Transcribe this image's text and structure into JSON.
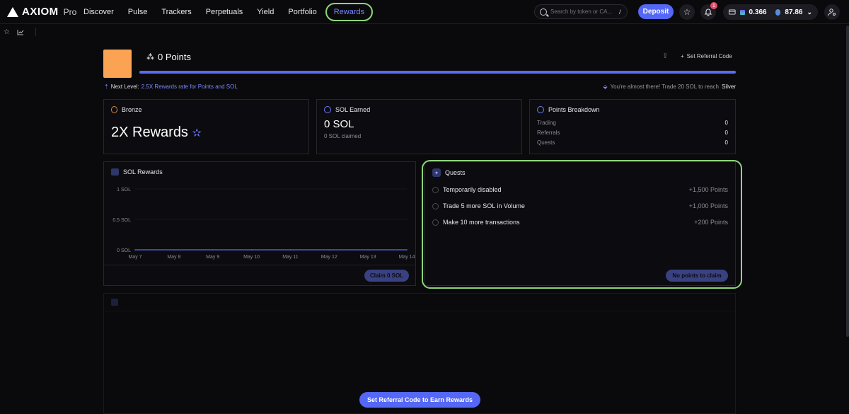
{
  "brand": {
    "name": "AXIOM",
    "tier": "Pro"
  },
  "nav": [
    {
      "label": "Discover"
    },
    {
      "label": "Pulse"
    },
    {
      "label": "Trackers"
    },
    {
      "label": "Perpetuals"
    },
    {
      "label": "Yield"
    },
    {
      "label": "Portfolio"
    },
    {
      "label": "Rewards",
      "active": true
    }
  ],
  "search": {
    "placeholder": "Search by token or CA...",
    "shortcut": "/"
  },
  "deposit_label": "Deposit",
  "notifications": {
    "count": "1"
  },
  "wallet": {
    "sol_balance": "0.366",
    "usd_balance": "87.86"
  },
  "profile": {
    "points": "0 Points",
    "set_referral": "Set Referral Code",
    "progress_pct": 100
  },
  "next_level": {
    "prefix": "Next Level:",
    "text": "2.5X Rewards rate for Points and SOL"
  },
  "almost": {
    "text": "You're almost there! Trade 20 SOL to reach",
    "tier": "Silver"
  },
  "bronze": {
    "title": "Bronze",
    "headline": "2X Rewards"
  },
  "sol_earned": {
    "title": "SOL Earned",
    "value": "0 SOL",
    "claimed": "0 SOL claimed"
  },
  "points_breakdown": {
    "title": "Points Breakdown",
    "rows": [
      {
        "label": "Trading",
        "value": "0"
      },
      {
        "label": "Referrals",
        "value": "0"
      },
      {
        "label": "Quests",
        "value": "0"
      }
    ]
  },
  "sol_rewards": {
    "title": "SOL Rewards",
    "claim_label": "Claim 0 SOL"
  },
  "chart_data": {
    "type": "line",
    "title": "SOL Rewards",
    "x": [
      "May 7",
      "May 8",
      "May 9",
      "May 10",
      "May 11",
      "May 12",
      "May 13",
      "May 14"
    ],
    "y_ticks": [
      "1 SOL",
      "0.5 SOL",
      "0 SOL"
    ],
    "ylim": [
      0,
      1
    ],
    "series": [
      {
        "values": [
          0,
          0,
          0,
          0,
          0,
          0,
          0,
          0
        ]
      }
    ],
    "grid": true,
    "colors": {
      "line": "#5a6cf5"
    }
  },
  "quests": {
    "title": "Quests",
    "items": [
      {
        "label": "Temporarily disabled",
        "points": "+1,500 Points"
      },
      {
        "label": "Trade 5 more SOL in Volume",
        "points": "+1,000 Points"
      },
      {
        "label": "Make 10 more transactions",
        "points": "+200 Points"
      }
    ],
    "claim_label": "No points to claim"
  },
  "referrals": {
    "cta": "Set Referral Code to Earn Rewards"
  }
}
